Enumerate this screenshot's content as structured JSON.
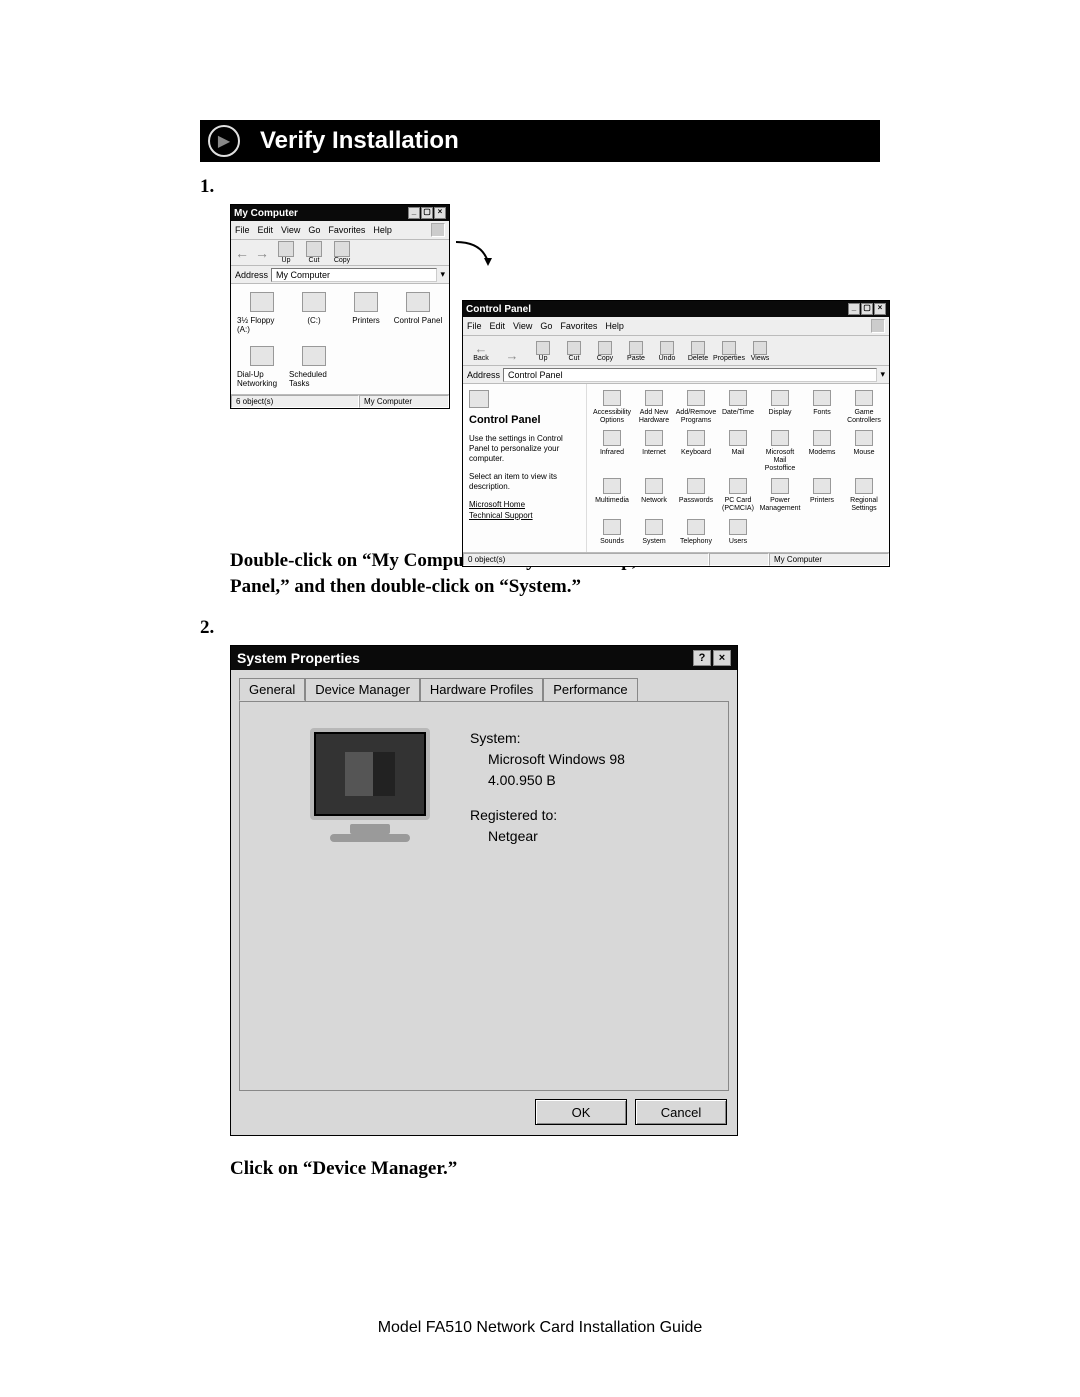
{
  "header": {
    "title": "Verify Installation"
  },
  "steps": {
    "one": "1.",
    "two": "2."
  },
  "myComputer": {
    "title": "My Computer",
    "menu": [
      "File",
      "Edit",
      "View",
      "Go",
      "Favorites",
      "Help"
    ],
    "toolbar": [
      "Up",
      "Cut",
      "Copy"
    ],
    "addressLabel": "Address",
    "addressValue": "My Computer",
    "icons": [
      "3½ Floppy (A:)",
      "(C:)",
      "Printers",
      "Control Panel",
      "Dial-Up Networking",
      "Scheduled Tasks"
    ],
    "status": {
      "left": "6 object(s)",
      "right": "My Computer"
    }
  },
  "controlPanel": {
    "title": "Control Panel",
    "menu": [
      "File",
      "Edit",
      "View",
      "Go",
      "Favorites",
      "Help"
    ],
    "toolbar": [
      "Back",
      "",
      "Up",
      "Cut",
      "Copy",
      "Paste",
      "Undo",
      "Delete",
      "Properties",
      "Views"
    ],
    "addressLabel": "Address",
    "addressValue": "Control Panel",
    "side": {
      "heading": "Control Panel",
      "p1": "Use the settings in Control Panel to personalize your computer.",
      "p2": "Select an item to view its description.",
      "link1": "Microsoft Home",
      "link2": "Technical Support"
    },
    "items": [
      "Accessibility Options",
      "Add New Hardware",
      "Add/Remove Programs",
      "Date/Time",
      "Display",
      "Fonts",
      "Game Controllers",
      "Infrared",
      "Internet",
      "Keyboard",
      "Mail",
      "Microsoft Mail Postoffice",
      "Modems",
      "Mouse",
      "Multimedia",
      "Network",
      "Passwords",
      "PC Card (PCMCIA)",
      "Power Management",
      "Printers",
      "Regional Settings",
      "Sounds",
      "System",
      "Telephony",
      "Users"
    ],
    "status": {
      "left": "0 object(s)",
      "right": "My Computer"
    }
  },
  "instruction1": "Double-click on “My Computer” on your desktop, double-click on “Control Panel,” and then double-click on “System.”",
  "sysProps": {
    "title": "System Properties",
    "tabs": [
      "General",
      "Device Manager",
      "Hardware Profiles",
      "Performance"
    ],
    "systemLabel": "System:",
    "systemLines": [
      "Microsoft Windows 98",
      "4.00.950 B"
    ],
    "regLabel": "Registered to:",
    "regLines": [
      "Netgear"
    ],
    "ok": "OK",
    "cancel": "Cancel"
  },
  "instruction2": "Click on “Device Manager.”",
  "footer": "Model FA510 Network Card Installation Guide"
}
